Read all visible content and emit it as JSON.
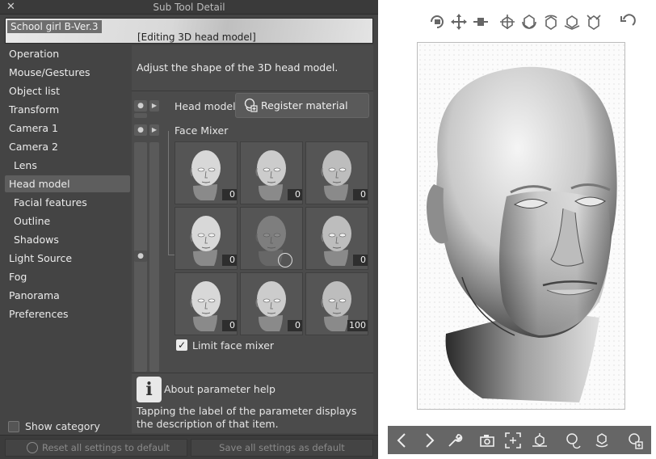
{
  "dialog": {
    "title": "Sub Tool Detail",
    "close_glyph": "✕",
    "preset_name": "School girl B-Ver.3",
    "editing_label": "[Editing 3D head model]",
    "description": "Adjust the shape of the 3D head model.",
    "head_model_label": "Head model",
    "register_material_label": "Register material",
    "face_mixer_label": "Face Mixer",
    "limit_face_mixer_label": "Limit face mixer",
    "limit_face_mixer_checked": true,
    "help_title": "About parameter help",
    "help_text": "Tapping the label of the parameter displays the description of that item.",
    "show_category_label": "Show category",
    "reset_label": "Reset all settings to default",
    "save_label": "Save all settings as default"
  },
  "categories": [
    {
      "label": "Operation",
      "sub": false,
      "active": false
    },
    {
      "label": "Mouse/Gestures",
      "sub": false,
      "active": false
    },
    {
      "label": "Object list",
      "sub": false,
      "active": false
    },
    {
      "label": "Transform",
      "sub": false,
      "active": false
    },
    {
      "label": "Camera 1",
      "sub": false,
      "active": false
    },
    {
      "label": "Camera 2",
      "sub": false,
      "active": false
    },
    {
      "label": "Lens",
      "sub": true,
      "active": false
    },
    {
      "label": "Head model",
      "sub": false,
      "active": true
    },
    {
      "label": "Facial features",
      "sub": true,
      "active": false
    },
    {
      "label": "Outline",
      "sub": true,
      "active": false
    },
    {
      "label": "Shadows",
      "sub": true,
      "active": false
    },
    {
      "label": "Light Source",
      "sub": false,
      "active": false
    },
    {
      "label": "Fog",
      "sub": false,
      "active": false
    },
    {
      "label": "Panorama",
      "sub": false,
      "active": false
    },
    {
      "label": "Preferences",
      "sub": false,
      "active": false
    }
  ],
  "face_mixer": [
    {
      "value": "0"
    },
    {
      "value": "0"
    },
    {
      "value": "0"
    },
    {
      "value": "0"
    },
    {
      "value": "",
      "disabled": true
    },
    {
      "value": "0"
    },
    {
      "value": "0"
    },
    {
      "value": "0"
    },
    {
      "value": "100"
    }
  ],
  "camera_toolbar_icons": [
    "rotate-camera-icon",
    "pan-camera-icon",
    "zoom-camera-icon",
    "move-object-icon",
    "rotate-object-icon",
    "rotate-object-y-icon",
    "rotate-object-plane-icon",
    "scale-object-icon",
    "undo-icon"
  ],
  "viewport_toolbar_icons": [
    "previous-icon",
    "next-icon",
    "settings-wrench-icon",
    "camera-angle-icon",
    "fit-view-icon",
    "ground-icon",
    "head-preset-icon",
    "reset-rotation-icon",
    "register-material-icon"
  ],
  "colors": {
    "panel_bg": "#444444",
    "selected_bg": "#5e5e5e",
    "viewport_bg": "#ffffff",
    "toolbar_bg": "#666666"
  }
}
